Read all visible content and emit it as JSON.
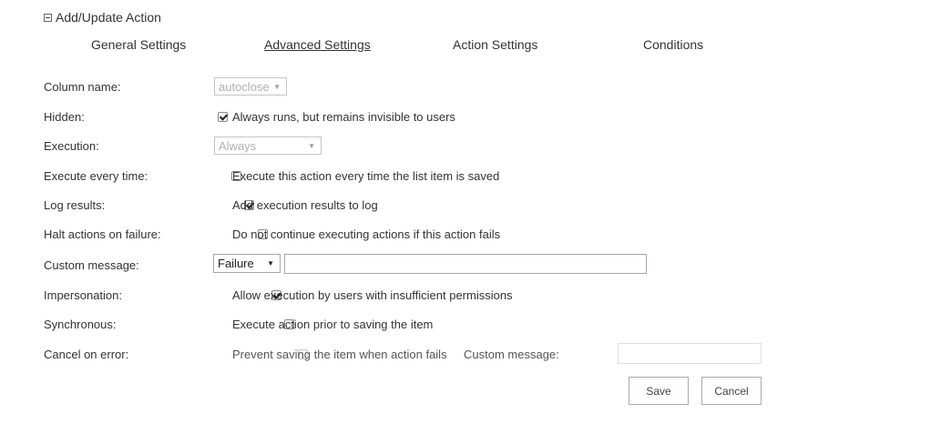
{
  "section": {
    "title": "Add/Update Action"
  },
  "tabs": [
    {
      "label": "General Settings"
    },
    {
      "label": "Advanced Settings"
    },
    {
      "label": "Action Settings"
    },
    {
      "label": "Conditions"
    }
  ],
  "active_tab": "Advanced Settings",
  "rows": {
    "column_name": {
      "label": "Column name:",
      "value": "autoclose",
      "disabled": true
    },
    "hidden": {
      "label": "Hidden:",
      "checkbox_label": "Always runs, but remains invisible to users",
      "checked": true
    },
    "execution": {
      "label": "Execution:",
      "value": "Always",
      "disabled": true
    },
    "execute_every_time": {
      "label": "Execute every time:",
      "checkbox_label": "Execute this action every time the list item is saved",
      "checked": false
    },
    "log_results": {
      "label": "Log results:",
      "checkbox_label": "Add execution results to log",
      "checked": true
    },
    "halt_on_failure": {
      "label": "Halt actions on failure:",
      "checkbox_label": "Do not continue executing actions if this action fails",
      "checked": false
    },
    "custom_message": {
      "label": "Custom message:",
      "select_value": "Failure",
      "text_value": ""
    },
    "impersonation": {
      "label": "Impersonation:",
      "checkbox_label": "Allow execution by users with insufficient permissions",
      "checked": true
    },
    "synchronous": {
      "label": "Synchronous:",
      "checkbox_label": "Execute action prior to saving the item",
      "checked": false
    },
    "cancel_on_error": {
      "label": "Cancel on error:",
      "checkbox_label": "Prevent saving the item when action fails",
      "checked": false,
      "disabled": true,
      "custom_message_label": "Custom message:",
      "custom_message_value": ""
    }
  },
  "buttons": {
    "save": "Save",
    "cancel": "Cancel"
  }
}
